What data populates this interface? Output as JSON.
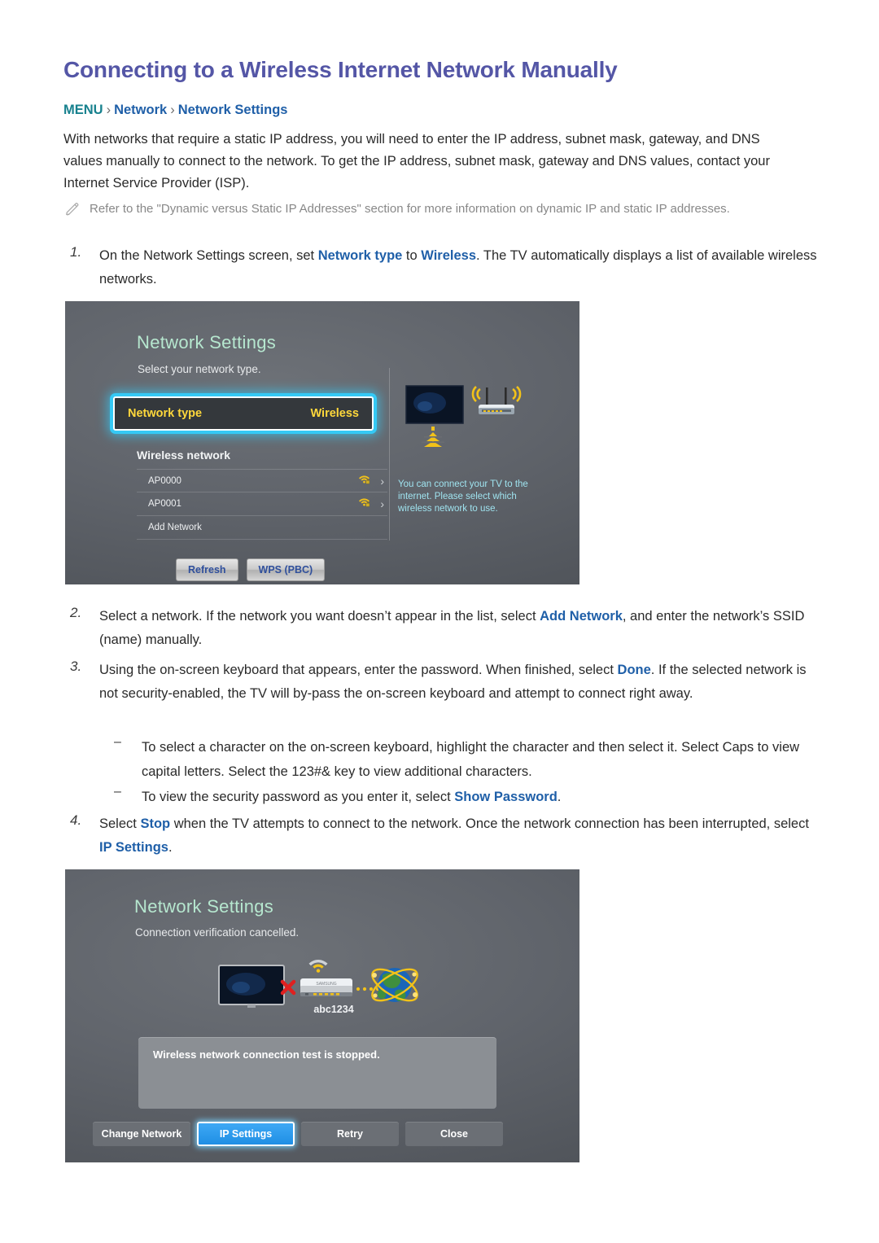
{
  "doc": {
    "title": "Connecting to a Wireless Internet Network Manually",
    "breadcrumb": {
      "menu": "MENU",
      "sep": "›",
      "level1": "Network",
      "level2": "Network Settings"
    },
    "intro": "With networks that require a static IP address, you will need to enter the IP address, subnet mask, gateway, and DNS values manually to connect to the network. To get the IP address, subnet mask, gateway and DNS values, contact your Internet Service Provider (ISP).",
    "note": {
      "icon": "pencil-icon",
      "text": "Refer to the \"Dynamic versus Static IP Addresses\" section for more information on dynamic IP and static IP addresses."
    }
  },
  "steps": [
    {
      "number": "1.",
      "part1": "On the Network Settings screen, set ",
      "link1": "Network type",
      "part2": " to ",
      "link2": "Wireless",
      "part3": ". The TV automatically displays a list of available wireless networks."
    },
    {
      "number": "2.",
      "part1": "Select a network. If the network you want doesn’t appear in the list, select ",
      "link1": "Add Network",
      "part2": ", and enter the network’s SSID (name) manually.",
      "link2": "",
      "part3": ""
    },
    {
      "number": "3.",
      "part1": "Using the on-screen keyboard that appears, enter the password. When finished, select ",
      "link1": "Done",
      "part2": ". If the selected network is not security-enabled, the TV will by-pass the on-screen keyboard and attempt to connect right away.",
      "link2": "",
      "part3": ""
    },
    {
      "number": "4.",
      "part1": "Select ",
      "link1": "Stop",
      "part2": " when the TV attempts to connect to the network. Once the network connection has been interrupted, select ",
      "link2": "IP Settings",
      "part3": "."
    }
  ],
  "substeps": [
    {
      "dash": "–",
      "part1": "To select a character on the on-screen keyboard, highlight the character and then select it. Select Caps to view capital letters. Select the 123#& key to view additional characters.",
      "link1": "",
      "part2": ""
    },
    {
      "dash": "–",
      "part1": "To view the security password as you enter it, select ",
      "link1": "Show Password",
      "part2": "."
    }
  ],
  "screen1": {
    "title": "Network Settings",
    "subtitle": "Select your network type.",
    "highlight_row": {
      "label": "Network type",
      "value": "Wireless"
    },
    "section_label": "Wireless network",
    "networks": [
      {
        "name": "AP0000",
        "icon": "wifi-locked-icon",
        "chevron": "›"
      },
      {
        "name": "AP0001",
        "icon": "wifi-locked-icon",
        "chevron": "›"
      },
      {
        "name": "Add Network",
        "icon": "",
        "chevron": ""
      }
    ],
    "side_text": "You can connect your TV to the internet. Please select which wireless network to use.",
    "buttons": [
      "Refresh",
      "WPS (PBC)"
    ]
  },
  "screen2": {
    "title": "Network Settings",
    "subtitle": "Connection verification cancelled.",
    "diagram": {
      "tv_icon": "tv-icon",
      "error_icon": "red-x-icon",
      "router_icon": "router-icon",
      "globe_icon": "globe-icon",
      "wifi_icon": "wifi-icon",
      "ssid": "abc1234"
    },
    "message": "Wireless network connection test is stopped.",
    "buttons": [
      {
        "label": "Change Network",
        "selected": false
      },
      {
        "label": "IP Settings",
        "selected": true
      },
      {
        "label": "Retry",
        "selected": false
      },
      {
        "label": "Close",
        "selected": false
      }
    ]
  },
  "colors": {
    "title": "#5456a6",
    "link": "#1f5fa8",
    "menu": "#17818e",
    "note": "#888888",
    "tv_title": "#b6e7cf",
    "highlight_text": "#ffd83b",
    "glow": "#35c9f5",
    "side_text": "#9fe3ef"
  }
}
